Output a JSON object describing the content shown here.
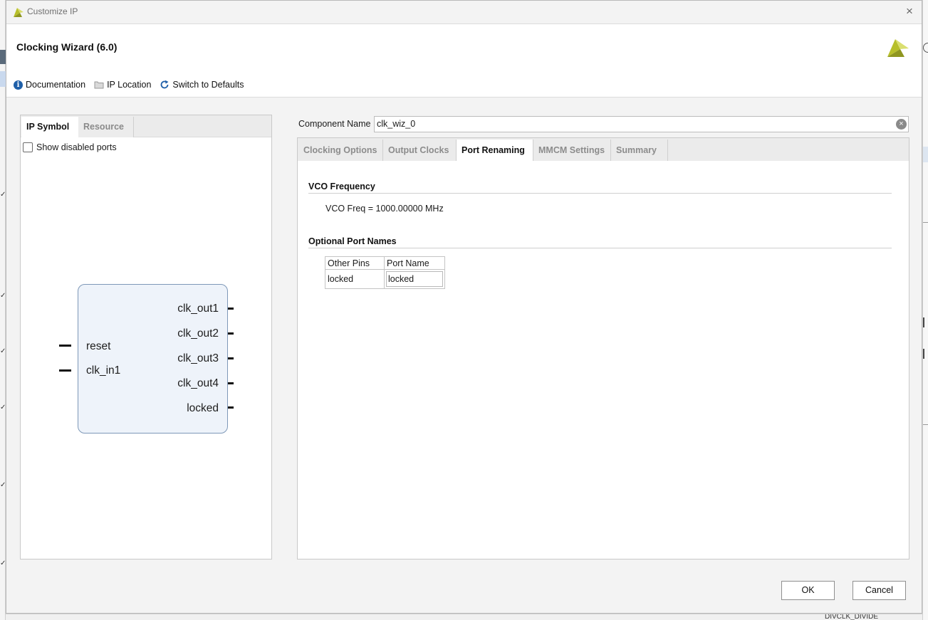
{
  "window": {
    "title": "Customize IP",
    "close_glyph": "×"
  },
  "header": {
    "title": "Clocking Wizard (6.0)",
    "links": [
      {
        "label": "Documentation",
        "icon": "info-icon"
      },
      {
        "label": "IP Location",
        "icon": "folder-icon"
      },
      {
        "label": "Switch to Defaults",
        "icon": "refresh-icon"
      }
    ]
  },
  "left_panel": {
    "tabs": [
      {
        "label": "IP Symbol",
        "active": true
      },
      {
        "label": "Resource",
        "active": false
      }
    ],
    "show_disabled_ports": {
      "label": "Show disabled ports",
      "checked": false
    },
    "symbol": {
      "inputs": [
        "reset",
        "clk_in1"
      ],
      "outputs": [
        "clk_out1",
        "clk_out2",
        "clk_out3",
        "clk_out4",
        "locked"
      ]
    }
  },
  "component": {
    "label": "Component Name",
    "value": "clk_wiz_0"
  },
  "right_panel": {
    "tabs": [
      {
        "label": "Clocking Options",
        "active": false
      },
      {
        "label": "Output Clocks",
        "active": false
      },
      {
        "label": "Port Renaming",
        "active": true
      },
      {
        "label": "MMCM Settings",
        "active": false
      },
      {
        "label": "Summary",
        "active": false
      }
    ],
    "vco": {
      "title": "VCO Frequency",
      "text": "VCO Freq = 1000.00000 MHz"
    },
    "optional_ports": {
      "title": "Optional Port Names",
      "columns": [
        "Other Pins",
        "Port Name"
      ],
      "rows": [
        {
          "pin": "locked",
          "name": "locked"
        }
      ]
    }
  },
  "buttons": {
    "ok": "OK",
    "cancel": "Cancel"
  },
  "background": {
    "bottom_text": "DIVCLK_DIVIDE"
  },
  "colors": {
    "symbol_fill": "#eef3fa",
    "symbol_border": "#7e98b8",
    "info_icon": "#1f5fa8",
    "brand": "#b7bf2a"
  }
}
